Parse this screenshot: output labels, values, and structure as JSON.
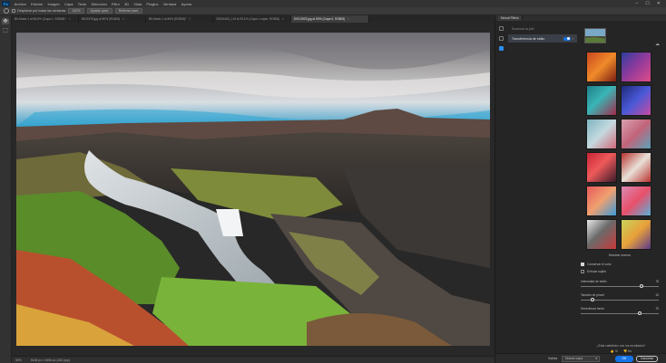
{
  "app": {
    "logo": "Ps"
  },
  "menu": [
    "Archivo",
    "Edición",
    "Imagen",
    "Capa",
    "Texto",
    "Selección",
    "Filtro",
    "3D",
    "Vista",
    "Plugins",
    "Ventana",
    "Ayuda"
  ],
  "window_controls": [
    "–",
    "☐",
    "✕"
  ],
  "options": {
    "scroll_all": "Desplazar por todas las ventanas",
    "zoom": "100%",
    "fit": "Ajustar pant.",
    "fill": "Rellenar pant."
  },
  "tabs": [
    {
      "label": "Bit-Mode-1 al 66,6% (Capa 1, RGB/8)*",
      "active": false
    },
    {
      "label": "BIN2378.jpg al 50% (RGB/8)",
      "active": false
    },
    {
      "label": "Bit-Mode-1 al 66% (RGB/8)*",
      "active": false
    },
    {
      "label": "20004453_1.tif al 25,1% (Capa 1 copia, RGB/8)",
      "active": false
    },
    {
      "label": "DSC4923.jpg al 50% (Capa 0, RGB/8)",
      "active": true
    }
  ],
  "status": {
    "zoom": "50%",
    "size": "5184 px x 3456 px (240 ppp)"
  },
  "panel": {
    "title": "Neural Filters",
    "filters": [
      {
        "label": "Suavizar la piel",
        "active": false
      },
      {
        "label": "Transferencia de estilo",
        "active": true
      }
    ],
    "more_styles": "Mostrar menos",
    "options": [
      {
        "label": "Conservar el color",
        "checked": true
      },
      {
        "label": "Enfocar sujeto",
        "checked": false
      }
    ],
    "sliders": [
      {
        "label": "Intensidad de estilo",
        "value": "78",
        "percent": 78
      },
      {
        "label": "Tamaño de pincel",
        "value": "15",
        "percent": 15
      },
      {
        "label": "Desenfocar fondo",
        "value": "75",
        "percent": 75
      }
    ],
    "question": "¿Está satisfecho con los resultados?",
    "yes": "Sí",
    "no": "No",
    "output_label": "Salida",
    "output_value": "Nueva capa",
    "ok": "OK",
    "cancel": "Cancelar"
  },
  "colors": {
    "accent": "#1473e6",
    "swatches": [
      "#c9461f",
      "#8a3a9c",
      "#1f7f8a",
      "#2d3f9e",
      "#7fb5c2",
      "#d9a1b0",
      "#c82436",
      "#b8342d",
      "#e85a5a",
      "#d98ab5",
      "#e8e8e8",
      "#c8d25a"
    ]
  }
}
